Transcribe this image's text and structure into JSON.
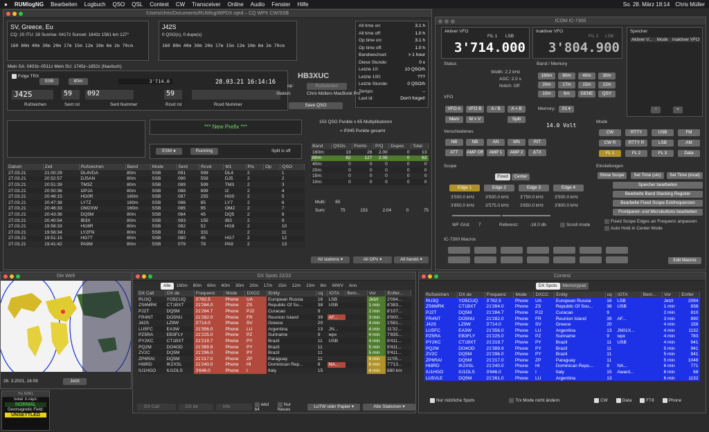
{
  "menubar": {
    "app": "RUMlogNG",
    "items": [
      "Bearbeiten",
      "Logbuch",
      "QSO",
      "QSL",
      "Contest",
      "CW",
      "Transceiver",
      "Online",
      "Audio",
      "Fenster",
      "Hilfe"
    ],
    "clock": "So. 28. März 18:14",
    "user": "Chris Müller"
  },
  "main": {
    "title": "/Users/chris/Documents/RUMlog/WPDX.rqed – CQ WPX CW/SSB",
    "dx_left": {
      "country": "SV, Greece, Eu",
      "info": "CQ: 20  ITU: 28  Sunrise: 0417z  Sunset: 1643z  1581 km  127°",
      "bands": "160 80m 40m 30m 20m 17m 15m 12m 10m  6m  2m 70cm"
    },
    "dx_right": {
      "call": "J42S",
      "info": "0 QSO(s), 0 dupe(s)",
      "bands": "160 80m 40m 30m 20m 17m 15m 12m 10m  6m  2m 70cm"
    },
    "sun_info": "Mein SA: 0403z–0511z  Mein SU: 1745z–1852z (Nautisch)",
    "stats": [
      [
        "All time on:",
        "3.1 h"
      ],
      [
        "All time off:",
        "1.0 h"
      ],
      [
        "Op time on:",
        "3.1 h"
      ],
      [
        "Op time off:",
        "1.0 h"
      ],
      [
        "Bandwechsel:",
        "> 1 hour"
      ],
      [
        "Diese Stunde:",
        "0 x"
      ],
      [
        "Letzte 10:",
        "10 QSO/h"
      ],
      [
        "Letzte 100:",
        "???"
      ],
      [
        "Letzte Stunde:",
        "0 QSO/h"
      ],
      [
        "Tempo:",
        "–"
      ],
      [
        "Last id:",
        "Don't forget!"
      ]
    ],
    "entry": {
      "folge_trx": "Folge TRX",
      "mode": "SSB",
      "band": "80m",
      "freq": "3'714.0",
      "datetime": "28.03.21  16:14:16",
      "call": "J42S",
      "sent_rst": "59",
      "sent_nr": "092",
      "rcvd_rst": "59",
      "rcvd_nr": "",
      "labels": [
        "Rufzeichen",
        "Sent rst",
        "Sent Nummer",
        "Rcvd rst",
        "Rcvd Nummer"
      ]
    },
    "station": {
      "callsign": "HB3XUC",
      "op_label": "op:",
      "op_btn": "Rufzeichen",
      "station_label": "Station:",
      "station_val": "Chris Müllers MacBook Pro",
      "save": "Save QSO"
    },
    "new_prefix": "*** New Prefix ***",
    "esm": "ESM",
    "running": "Running",
    "split": "Split is off",
    "score": {
      "line1": "153 QSO Punkte x 65 Multiplikatoren",
      "line2": "= 9'945 Punkte gesamt",
      "headers": [
        "Band",
        "QSOs",
        "Points",
        "P/Q",
        "Dupes",
        "Total"
      ],
      "rows": [
        [
          "160m:",
          "13",
          "26",
          "2.00",
          "0",
          "13"
        ],
        [
          "80m:",
          "62",
          "127",
          "2.05",
          "0",
          "62"
        ],
        [
          "40m:",
          "0",
          "0",
          "0",
          "0",
          "0"
        ],
        [
          "20m:",
          "0",
          "0",
          "0",
          "0",
          "0"
        ],
        [
          "15m:",
          "0",
          "0",
          "0",
          "0",
          "0"
        ],
        [
          "10m:",
          "0",
          "0",
          "0",
          "0",
          "0"
        ]
      ],
      "multi": [
        "Multi:",
        "65"
      ],
      "sum": [
        "Sum:",
        "75",
        "153",
        "2.04",
        "0",
        "75"
      ]
    },
    "filters": [
      "All stations",
      "All OPs",
      "All bands"
    ],
    "log_headers": [
      "Datum",
      "Zeit",
      "Rufzeichen",
      "Band",
      "Mode",
      "Sent",
      "Rcvd",
      "M1",
      "Pts",
      "Op",
      "QSO"
    ],
    "log": [
      [
        "27.03.21",
        "21:00:29",
        "DL4VDA",
        "80m",
        "SSB",
        "091",
        "599",
        "DL4",
        "2",
        "",
        "1"
      ],
      [
        "27.03.21",
        "20:52:57",
        "DJ5AN",
        "80m",
        "SSB",
        "090",
        "559",
        "DJ5",
        "2",
        "",
        "2"
      ],
      [
        "27.03.21",
        "20:51:39",
        "TM3Z",
        "80m",
        "SSB",
        "089",
        "599",
        "TM3",
        "2",
        "",
        "3"
      ],
      [
        "27.03.21",
        "20:50:36",
        "I2PJA",
        "80m",
        "SSB",
        "088",
        "899",
        "I2",
        "2",
        "",
        "4"
      ],
      [
        "27.03.21",
        "20:48:15",
        "HG0R",
        "160m",
        "SSB",
        "087",
        "255",
        "HG0",
        "2",
        "",
        "5"
      ],
      [
        "27.03.21",
        "20:47:38",
        "LY7Z",
        "160m",
        "SSB",
        "086",
        "85",
        "LY7",
        "2",
        "",
        "6"
      ],
      [
        "27.03.21",
        "20:46:33",
        "OM2XW",
        "160m",
        "SSB",
        "085",
        "95",
        "OM2",
        "2",
        "",
        "7"
      ],
      [
        "27.03.21",
        "20:43:36",
        "DQ5M",
        "80m",
        "SSB",
        "084",
        "45",
        "DQ5",
        "2",
        "",
        "8"
      ],
      [
        "27.03.21",
        "20:40:54",
        "IB3X",
        "80m",
        "SSB",
        "083",
        "155",
        "IB3",
        "2",
        "",
        "9"
      ],
      [
        "27.03.21",
        "19:58:33",
        "HG8R",
        "80m",
        "SSB",
        "082",
        "52",
        "HG8",
        "2",
        "",
        "10"
      ],
      [
        "27.03.21",
        "19:56:34",
        "LY2FN",
        "80m",
        "SSB",
        "081",
        "331",
        "",
        "2",
        "",
        "11"
      ],
      [
        "27.03.21",
        "19:51:15",
        "HG7T",
        "80m",
        "SSB",
        "080",
        "45",
        "HG7",
        "2",
        "",
        "12"
      ],
      [
        "27.03.21",
        "19:41:42",
        "PA9M",
        "80m",
        "SSB",
        "079",
        "78",
        "PA9",
        "2",
        "",
        "13"
      ]
    ]
  },
  "rig": {
    "title": "ICOM IC-7300",
    "active_label": "Aktiver VFO",
    "fil": "FIL 1",
    "mode": "LSB",
    "active_freq": "3'714.000",
    "inactive_label": "Inaktiver VFO",
    "fil2": "FIL 2",
    "mode2": "LSB",
    "inactive_freq": "3'804.900",
    "memory_label": "Speicher",
    "mem_headers": [
      "Aktiver V...",
      "Mode",
      "Inaktiver VFO"
    ],
    "status_label": "Status",
    "status": [
      [
        "Width: 2.2 kHz"
      ],
      [
        "AGC: 2.0 s"
      ],
      [
        "Notch: Off"
      ]
    ],
    "band_label": "Band / Memory",
    "bands": [
      "160m",
      "80m",
      "40m",
      "30m",
      "20m",
      "17m",
      "15m",
      "12m",
      "10m",
      "6m",
      "GENE",
      "QSY"
    ],
    "vfo_label": "VFO",
    "vfo_btns": [
      "VFO A",
      "VFO B",
      "A / B",
      "A = B"
    ],
    "mem_btns": [
      "Mem",
      "M > V"
    ],
    "split_btn": "Split",
    "memory": "Memory:",
    "memory_val": "01",
    "volt": "14.0 Volt",
    "mode_label": "Mode",
    "modes": [
      "CW",
      "RTTY",
      "USB",
      "FM",
      "CW R",
      "RTTY R",
      "LSB",
      "AM",
      "FL 1",
      "FL 2",
      "FL 3",
      "Data"
    ],
    "misc_label": "Verschiedenes",
    "misc": [
      "NB",
      "NB",
      "AN",
      "MN",
      "RIT",
      "ATT",
      "AMP Off",
      "AMP 1",
      "AMP 2",
      "ΔTX"
    ],
    "scope_label": "Scope",
    "scope_tabs": [
      "Fixed",
      "Center"
    ],
    "edges": [
      "Edge 1",
      "Edge 2",
      "Edge 3",
      "Edge 4"
    ],
    "edge_rows": [
      [
        "3'500.0 kHz",
        "3'500.0 kHz",
        "3'750.0 kHz",
        "3'500.0 kHz"
      ],
      [
        "3'850.0 kHz",
        "3'575.0 kHz",
        "3'850.0 kHz",
        "3'800.0 kHz"
      ]
    ],
    "wf_grid": "WF Grid:",
    "wf_val": "7",
    "ref": "Referenz:",
    "ref_val": "-18.0 db",
    "scroll": "Scroll mode",
    "settings_label": "Einstellungen",
    "settings": [
      "Show Scope",
      "Set Time (utc)",
      "Set Time (local)"
    ],
    "settings_btns": [
      "Speicher bearbeiten",
      "Bearbeite Band Stacking Register",
      "Bearbeite Fixed Scope Eckfrequenzen",
      "Frontpanel- und Microbuttons bearbeiten"
    ],
    "checks": [
      "Fixed Scope Edges an Frequenz anpassen",
      "Auto Hold in Center Mode"
    ],
    "macros_label": "IC-7300 Macros",
    "edit_macros": "Edit Macros"
  },
  "world": {
    "title": "Die Welt",
    "datetime": "28.  3.2021, 16:09",
    "now": "Jetzt",
    "solar_title": "Trx N3KL",
    "xray_label": "Solar X-rays:",
    "xray": "NORMAL",
    "geo_label": "Geomagnetic Field:",
    "geo": "UNSETTLED"
  },
  "spots": {
    "title": "DX Spots 22/22",
    "tabs": [
      "Alle",
      "160m",
      "80m",
      "60m",
      "40m",
      "30m",
      "20m",
      "17m",
      "15m",
      "12m",
      "10m",
      "8m",
      "WWV",
      "Ann"
    ],
    "headers": [
      "DX Call",
      "DX de",
      "Frequenz",
      "Mode",
      "DXCC",
      "Entity",
      "cq",
      "IOTA",
      "Bem...",
      "Vor",
      "Entfer..."
    ],
    "rows": [
      [
        "RU3Q",
        "YO5CUQ",
        "3'762.5",
        "Phone",
        "UA",
        "European Russia",
        "16",
        "LSB",
        "",
        "Jetzt",
        "2'094..."
      ],
      [
        "ZS6MRK",
        "CT1BXT",
        "21'264.0",
        "Phone",
        "ZS",
        "Republic Of So...",
        "38",
        "USB",
        "",
        "1 min",
        "8'383..."
      ],
      [
        "PJ2T",
        "DQ5M",
        "21'284.7",
        "Phone",
        "PJ2",
        "Curacao",
        "9",
        "",
        "",
        "2 min",
        "8'107..."
      ],
      [
        "FR4NT",
        "DO5NU",
        "21'282.0",
        "Phone",
        "FR",
        "Reunion Island",
        "39",
        "AF...",
        "",
        "3 min",
        "8'900..."
      ],
      [
        "J42S",
        "LZ9W",
        "3'714.0",
        "Phone",
        "SV",
        "Greece",
        "20",
        "",
        "",
        "4 min",
        "1'581..."
      ],
      [
        "LU5FC",
        "EA3W",
        "21'356.0",
        "Phone",
        "LU",
        "Argentina",
        "13",
        "JN...",
        "",
        "4 min",
        "11'32..."
      ],
      [
        "PZ5RA",
        "EB3FLY",
        "21'225.0",
        "Phone",
        "PZ",
        "Suriname",
        "9",
        "wpx",
        "",
        "4 min",
        "7'835..."
      ],
      [
        "PY2KC",
        "CT1BXT",
        "21'219.7",
        "Phone",
        "PY",
        "Brazil",
        "11",
        "USB",
        "",
        "4 min",
        "9'411..."
      ],
      [
        "PQ2M",
        "DO4OD",
        "21'389.9",
        "Phone",
        "PY",
        "Brazil",
        "11",
        "",
        "",
        "5 min",
        "9'411..."
      ],
      [
        "ZV2C",
        "DQ5M",
        "21'296.0",
        "Phone",
        "PY",
        "Brazil",
        "11",
        "",
        "",
        "5 min",
        "9'411..."
      ],
      [
        "ZP6RAI",
        "DQ5M",
        "21'217.0",
        "Phone",
        "ZP",
        "Paraguay",
        "11",
        "",
        "",
        "6 min",
        "11'05..."
      ],
      [
        "HI8RD",
        "IK2XSL",
        "21'240.0",
        "Phone",
        "HI",
        "Dominican Rep...",
        "8",
        "NA...",
        "",
        "6 min",
        "7'713..."
      ],
      [
        "IU1HGO",
        "IU1OLS",
        "3'646.0",
        "Phone",
        "I",
        "Italy",
        "15",
        "",
        "",
        "4 min",
        "680 km"
      ]
    ],
    "dxcall_ph": "DX Call",
    "dxde_ph": "DX de",
    "info_ph": "Info",
    "wkd": "wkd b4",
    "nur_neues": "Nur Neues",
    "lotw": "LoTW oder Papier",
    "alle": "Alle Stationen"
  },
  "contest": {
    "title": "Contest",
    "tabs": [
      "DX Spots",
      "Memorypad"
    ],
    "headers": [
      "Rufzeichen",
      "DX de",
      "Frequenz",
      "Mode",
      "DXCC",
      "Entity",
      "cq",
      "IOTA",
      "Bem...",
      "Vor",
      "Entfer"
    ],
    "rows": [
      [
        "RU3Q",
        "YO5CUQ",
        "3'762.5",
        "Phone",
        "UA",
        "European Russia",
        "16",
        "LSB",
        "",
        "Jetzt",
        "2094"
      ],
      [
        "ZS6MRK",
        "CT1BXT",
        "21'264.0",
        "Phone",
        "ZS",
        "Republic Of Sou...",
        "38",
        "USB",
        "",
        "1 min",
        "838"
      ],
      [
        "PJ2T",
        "DQ5M",
        "21'284.7",
        "Phone",
        "PJ2",
        "Curacao",
        "9",
        "",
        "",
        "2 min",
        "810"
      ],
      [
        "FR4NT",
        "DO5NU",
        "21'282.0",
        "Phone",
        "FR",
        "Reunion Island",
        "39",
        "AF...",
        "",
        "3 min",
        "890"
      ],
      [
        "J42S",
        "LZ9W",
        "3'714.0",
        "Phone",
        "SV",
        "Greece",
        "20",
        "",
        "",
        "4 min",
        "158"
      ],
      [
        "LU5FC",
        "EA3W",
        "21'356.0",
        "Phone",
        "LU",
        "Argentina",
        "13",
        "JN01X...",
        "",
        "4 min",
        "1132"
      ],
      [
        "PZ5RA",
        "EB3FLY",
        "21'225.0",
        "Phone",
        "PZ",
        "Suriname",
        "9",
        "wpx",
        "",
        "4 min",
        "783"
      ],
      [
        "PY2KC",
        "CT1BXT",
        "21'219.7",
        "Phone",
        "PY",
        "Brazil",
        "11",
        "USB",
        "",
        "4 min",
        "941"
      ],
      [
        "PQ2M",
        "DO4OD",
        "21'389.9",
        "Phone",
        "PY",
        "Brazil",
        "11",
        "",
        "",
        "5 min",
        "941"
      ],
      [
        "ZV2C",
        "DQ5M",
        "21'296.0",
        "Phone",
        "PY",
        "Brazil",
        "11",
        "",
        "",
        "5 min",
        "941"
      ],
      [
        "ZP6RAI",
        "DQ5M",
        "21'217.0",
        "Phone",
        "ZP",
        "Paraguay",
        "11",
        "",
        "",
        "5 min",
        "1048"
      ],
      [
        "HI8RD",
        "IK2XSL",
        "21'240.0",
        "Phone",
        "HI",
        "Dominican Repu...",
        "8",
        "NA...",
        "",
        "6 min",
        "771"
      ],
      [
        "IU1HGO",
        "IU1OLS",
        "3'646.0",
        "Phone",
        "I",
        "Italy",
        "15",
        "Award...",
        "",
        "6 min",
        "68"
      ],
      [
        "LU5VLE",
        "DQ5M",
        "21'261.0",
        "Phone",
        "LU",
        "Argentina",
        "13",
        "",
        "",
        "6 min",
        "1132"
      ]
    ],
    "bottom": [
      "Nur nützliche Spots",
      "Trx Mode nicht ändern",
      "CW",
      "Data",
      "FT8",
      "Phone"
    ]
  }
}
